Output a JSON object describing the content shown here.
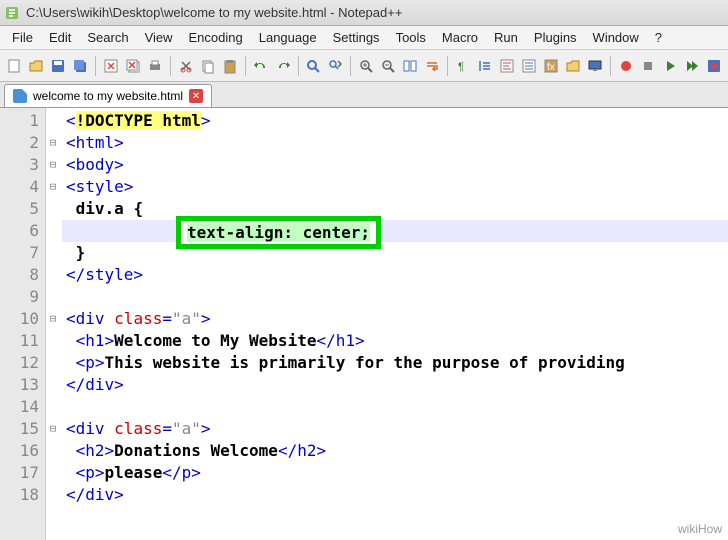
{
  "titlebar": {
    "path": "C:\\Users\\wikih\\Desktop\\welcome to my website.html - Notepad++"
  },
  "menu": {
    "items": [
      "File",
      "Edit",
      "Search",
      "View",
      "Encoding",
      "Language",
      "Settings",
      "Tools",
      "Macro",
      "Run",
      "Plugins",
      "Window",
      "?"
    ]
  },
  "tab": {
    "filename": "welcome to my website.html"
  },
  "highlight": {
    "text": "text-align: center;"
  },
  "code": {
    "lines": [
      {
        "n": 1,
        "html": "<span class='tag'>&lt;</span><span class='doctype'>!DOCTYPE html</span><span class='tag'>&gt;</span>"
      },
      {
        "n": 2,
        "fold": true,
        "html": "<span class='tag'>&lt;html&gt;</span>"
      },
      {
        "n": 3,
        "fold": true,
        "html": "<span class='tag'>&lt;body&gt;</span>"
      },
      {
        "n": 4,
        "fold": true,
        "html": "<span class='tag'>&lt;style&gt;</span>"
      },
      {
        "n": 5,
        "html": " <span class='txt'>div.a </span><span class='bracket'>{</span>"
      },
      {
        "n": 6,
        "caret": true,
        "html": "     "
      },
      {
        "n": 7,
        "html": " <span class='bracket'>}</span>"
      },
      {
        "n": 8,
        "html": "<span class='tag'>&lt;/style&gt;</span>"
      },
      {
        "n": 9,
        "html": ""
      },
      {
        "n": 10,
        "fold": true,
        "html": "<span class='tag'>&lt;div</span> <span class='attr'>class</span><span class='tag'>=</span><span class='str'>\"a\"</span><span class='tag'>&gt;</span>"
      },
      {
        "n": 11,
        "html": " <span class='tag'>&lt;h1&gt;</span><span class='txt'>Welcome to My Website</span><span class='tag'>&lt;/h1&gt;</span>"
      },
      {
        "n": 12,
        "html": " <span class='tag'>&lt;p&gt;</span><span class='txt'>This website is primarily for the purpose of providing</span>"
      },
      {
        "n": 13,
        "html": "<span class='tag'>&lt;/div&gt;</span>"
      },
      {
        "n": 14,
        "html": ""
      },
      {
        "n": 15,
        "fold": true,
        "html": "<span class='tag'>&lt;div</span> <span class='attr'>class</span><span class='tag'>=</span><span class='str'>\"a\"</span><span class='tag'>&gt;</span>"
      },
      {
        "n": 16,
        "html": " <span class='tag'>&lt;h2&gt;</span><span class='txt'>Donations Welcome</span><span class='tag'>&lt;/h2&gt;</span>"
      },
      {
        "n": 17,
        "html": " <span class='tag'>&lt;p&gt;</span><span class='txt'>please</span><span class='tag'>&lt;/p&gt;</span>"
      },
      {
        "n": 18,
        "html": "<span class='tag'>&lt;/div&gt;</span>"
      }
    ]
  },
  "watermark": "wikiHow"
}
